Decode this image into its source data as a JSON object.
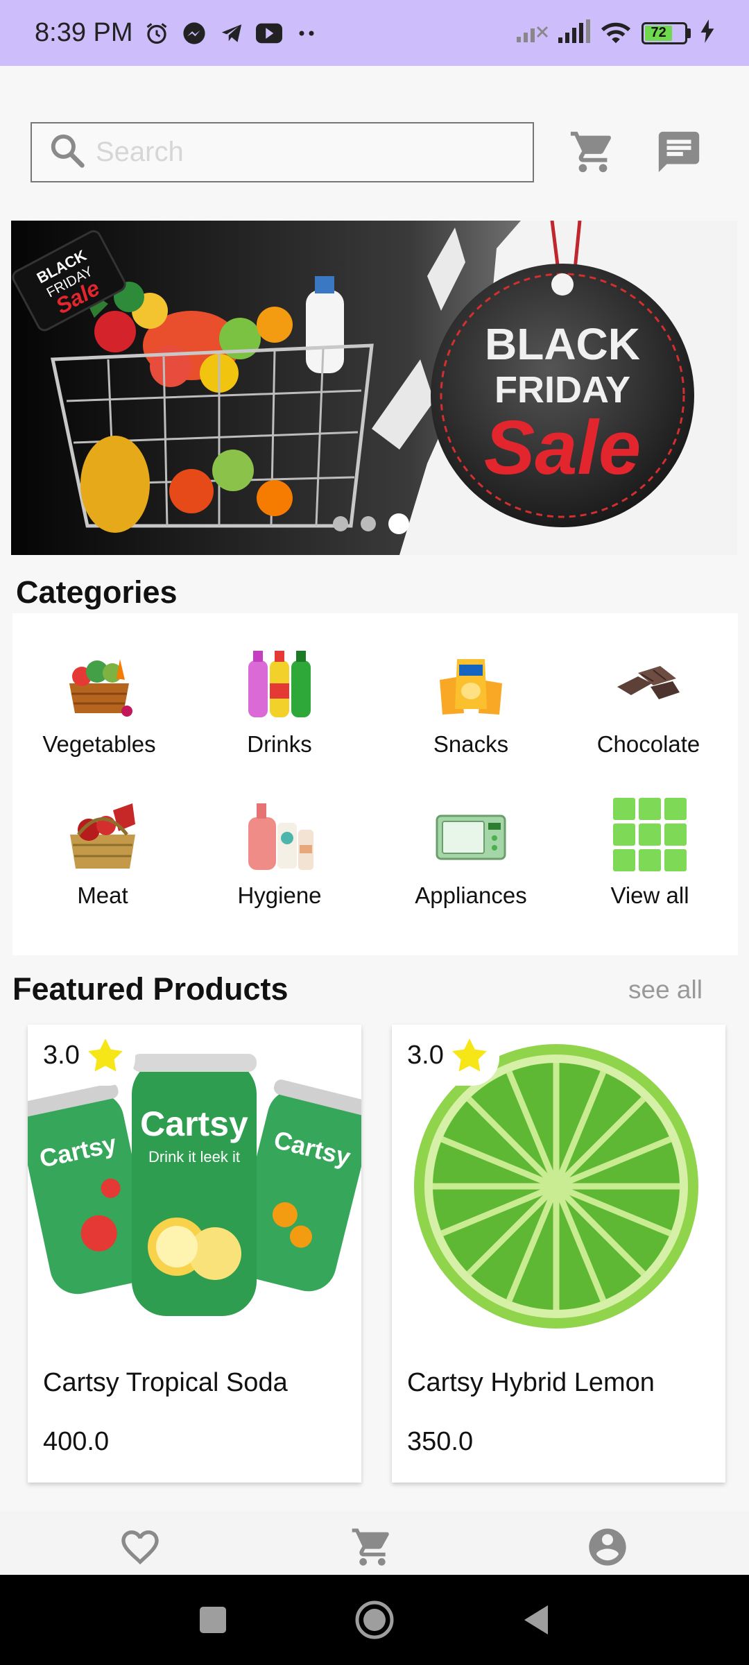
{
  "status_bar": {
    "time": "8:39 PM",
    "battery": "72"
  },
  "search": {
    "placeholder": "Search"
  },
  "banner": {
    "tag_line1": "BLACK",
    "tag_line2": "FRIDAY",
    "tag_line3": "Sale",
    "small_tag_line1": "BLACK",
    "small_tag_line2": "FRIDAY",
    "small_tag_line3": "Sale",
    "page_count": 3,
    "active_page": 3
  },
  "categories": {
    "title": "Categories",
    "items": [
      {
        "label": "Vegetables",
        "icon": "vegetable-basket-icon"
      },
      {
        "label": "Drinks",
        "icon": "drink-bottles-icon"
      },
      {
        "label": "Snacks",
        "icon": "chips-bags-icon"
      },
      {
        "label": "Chocolate",
        "icon": "chocolate-icon"
      },
      {
        "label": "Meat",
        "icon": "meat-basket-icon"
      },
      {
        "label": "Hygiene",
        "icon": "hygiene-products-icon"
      },
      {
        "label": "Appliances",
        "icon": "microwave-icon"
      },
      {
        "label": "View all",
        "icon": "grid-icon"
      }
    ]
  },
  "featured": {
    "title": "Featured Products",
    "see_all": "see all",
    "products": [
      {
        "name": "Cartsy Tropical Soda",
        "price": "400.0",
        "rating": "3.0",
        "can_brand": "Cartsy",
        "can_slogan": "Drink it leek it"
      },
      {
        "name": "Cartsy Hybrid Lemon",
        "price": "350.0",
        "rating": "3.0"
      }
    ]
  },
  "colors": {
    "status_bar": "#cdbdfb",
    "accent_green": "#7ed957",
    "star": "#f7e617",
    "icon_gray": "#8a8a8a"
  }
}
